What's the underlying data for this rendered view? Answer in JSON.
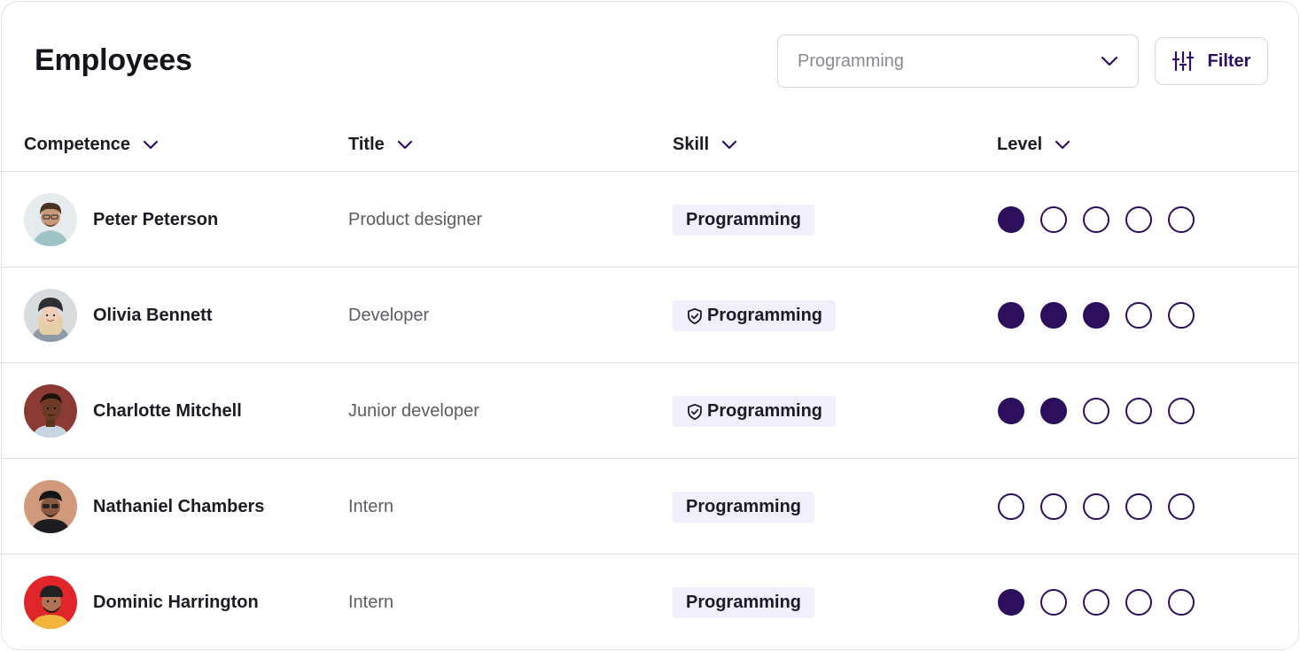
{
  "header": {
    "title": "Employees",
    "select_value": "Programming",
    "filter_label": "Filter"
  },
  "columns": {
    "competence": "Competence",
    "title": "Title",
    "skill": "Skill",
    "level": "Level"
  },
  "colors": {
    "accent": "#2d0f5e",
    "badge_bg": "#f1effb",
    "border": "#dedee3"
  },
  "rows": [
    {
      "name": "Peter Peterson",
      "title": "Product designer",
      "skill": "Programming",
      "verified": false,
      "level": 1,
      "level_max": 5,
      "avatar": "avatar-peter"
    },
    {
      "name": "Olivia Bennett",
      "title": "Developer",
      "skill": "Programming",
      "verified": true,
      "level": 3,
      "level_max": 5,
      "avatar": "avatar-olivia"
    },
    {
      "name": "Charlotte Mitchell",
      "title": "Junior developer",
      "skill": "Programming",
      "verified": true,
      "level": 2,
      "level_max": 5,
      "avatar": "avatar-charlotte"
    },
    {
      "name": "Nathaniel Chambers",
      "title": "Intern",
      "skill": "Programming",
      "verified": false,
      "level": 0,
      "level_max": 5,
      "avatar": "avatar-nathaniel"
    },
    {
      "name": "Dominic Harrington",
      "title": "Intern",
      "skill": "Programming",
      "verified": false,
      "level": 1,
      "level_max": 5,
      "avatar": "avatar-dominic"
    }
  ]
}
